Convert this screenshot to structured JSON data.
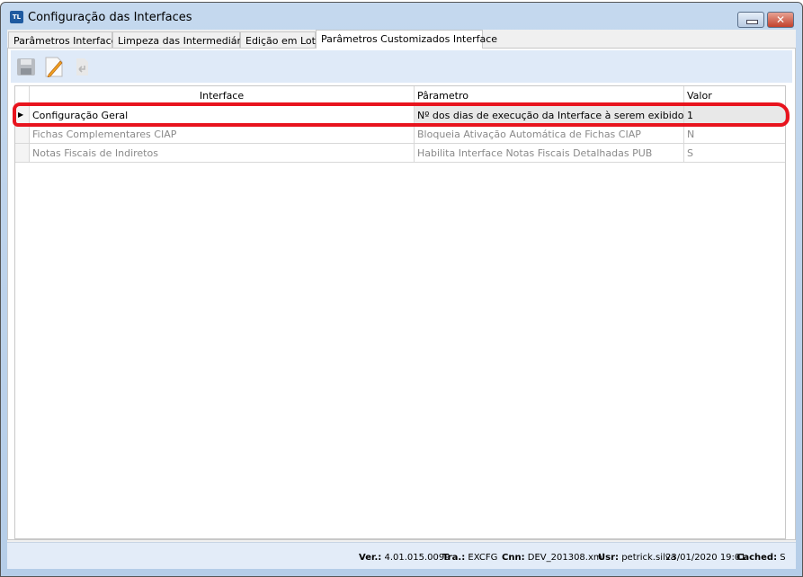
{
  "window": {
    "title": "Configuração das Interfaces",
    "app_icon": "TL"
  },
  "tabs": [
    {
      "label": "Parâmetros Interface"
    },
    {
      "label": "Limpeza das Intermediárias"
    },
    {
      "label": "Edição em Lote"
    },
    {
      "label": "Parâmetros Customizados Interface",
      "active": true
    }
  ],
  "toolbar": {
    "icons": [
      "save-icon",
      "edit-icon",
      "undo-icon"
    ]
  },
  "grid": {
    "headers": [
      "Interface",
      "Pârametro",
      "Valor"
    ],
    "rows": [
      {
        "interface": "Configuração Geral",
        "parametro": "Nº dos dias de execução da Interface à serem exibidos",
        "valor": "1",
        "selected": true
      },
      {
        "interface": "Fichas Complementares CIAP",
        "parametro": "Bloqueia Ativação Automática de Fichas CIAP",
        "valor": "N"
      },
      {
        "interface": "Notas Fiscais de Indiretos",
        "parametro": "Habilita Interface Notas Fiscais Detalhadas PUB",
        "valor": "S"
      }
    ]
  },
  "status": {
    "ver_label": "Ver.:",
    "ver": "4.01.015.0099",
    "tra_label": "Tra.:",
    "tra": "EXCFG",
    "cnn_label": "Cnn:",
    "cnn": "DEV_201308.xml",
    "usr_label": "Usr:",
    "usr": "petrick.silva",
    "datetime": "23/01/2020 19:01",
    "cached_label": "Cached:",
    "cached": "S"
  },
  "colors": {
    "highlight": "#e8141e"
  }
}
